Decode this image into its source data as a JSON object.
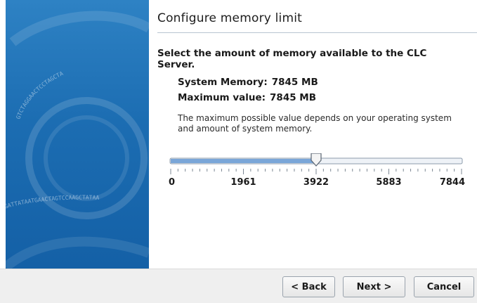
{
  "page": {
    "title": "Configure memory limit",
    "subtitle": "Select the amount of memory available to the CLC Server.",
    "system_memory_label": "System Memory:",
    "system_memory_value": "7845 MB",
    "max_value_label": "Maximum value:",
    "max_value_value": "7845 MB",
    "note": "The maximum possible value depends on your operating system and amount of system memory."
  },
  "slider": {
    "min": 0,
    "max": 7844,
    "value": 3922,
    "tick_labels": [
      "0",
      "1961",
      "3922",
      "5883",
      "7844"
    ]
  },
  "side_panel": {
    "text_a": "GTCTAGGAACTCCTAGCTA",
    "text_b": "CCGATTATAATGAACTAGTCCAAGCTATAA"
  },
  "buttons": {
    "back": "< Back",
    "next": "Next >",
    "cancel": "Cancel"
  },
  "colors": {
    "side_panel": "#1c6db2",
    "slider_fill": "#7aa6d8",
    "footer": "#efefef"
  }
}
